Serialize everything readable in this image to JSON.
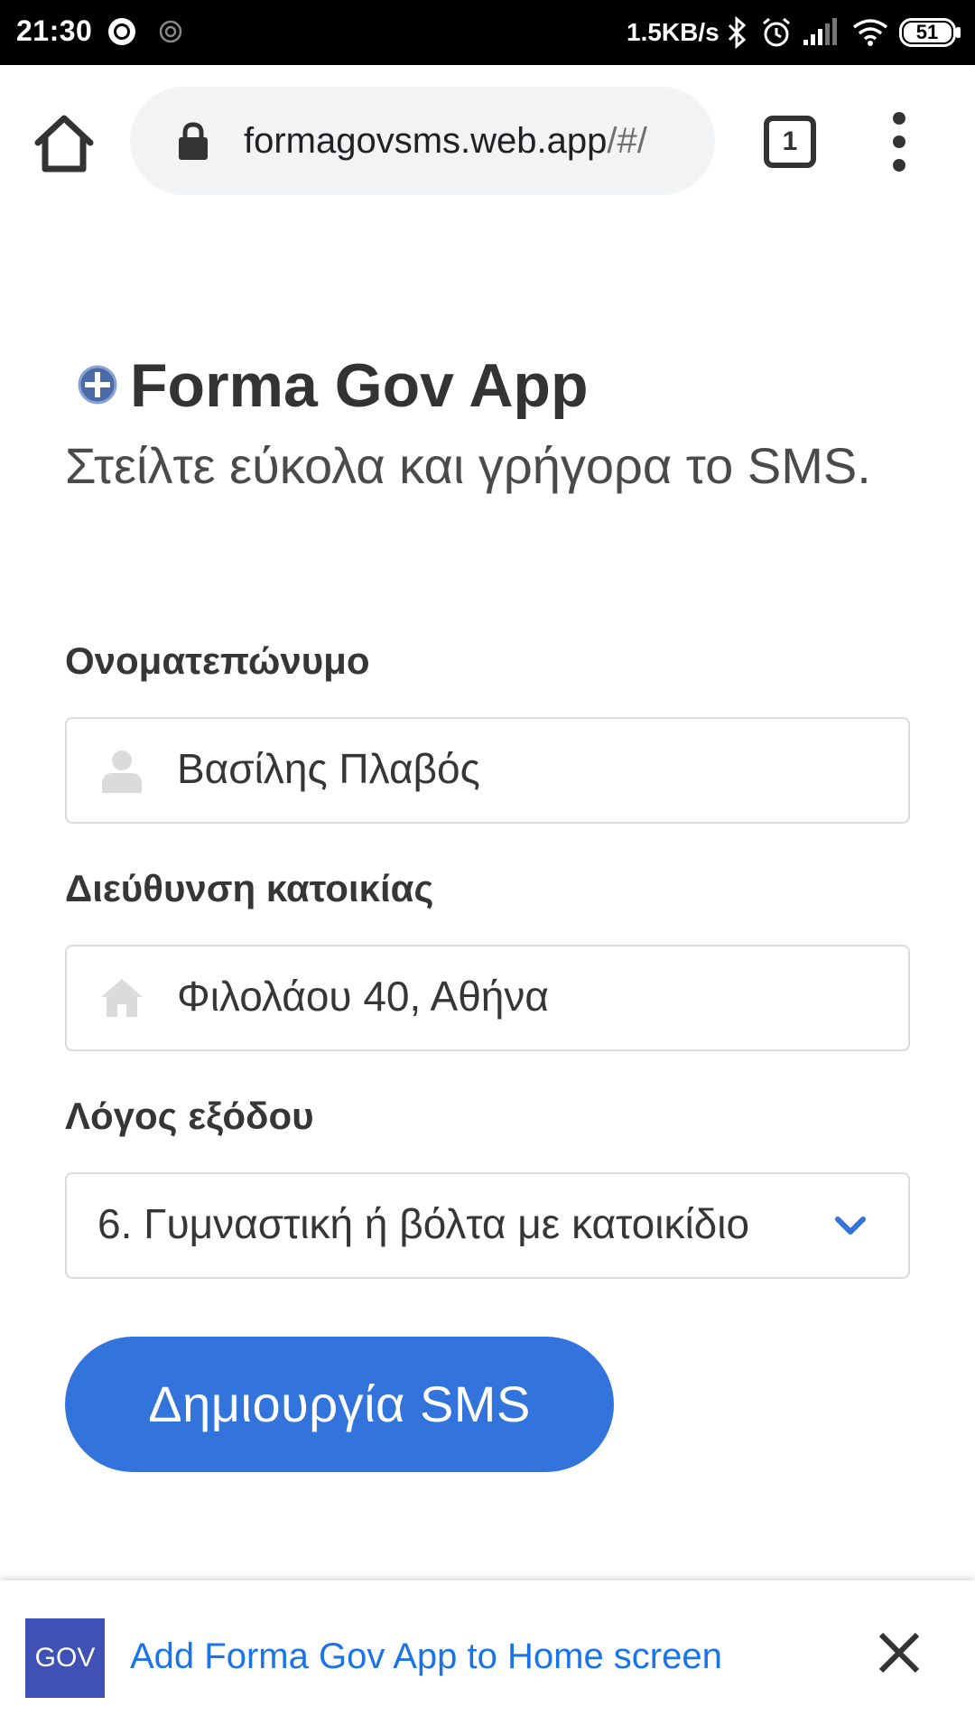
{
  "status_bar": {
    "time": "21:30",
    "net_speed": "1.5KB/s",
    "battery": "51"
  },
  "browser": {
    "url_domain": "formagovsms.web.app",
    "url_path": "/#/",
    "tab_count": "1"
  },
  "page": {
    "title": "Forma Gov App",
    "subtitle": "Στείλτε εύκολα και γρήγορα το SMS.",
    "fields": {
      "name": {
        "label": "Ονοματεπώνυμο",
        "value": "Βασίλης Πλαβός",
        "icon": "user-icon"
      },
      "address": {
        "label": "Διεύθυνση κατοικίας",
        "value": "Φιλολάου 40, Αθήνα",
        "icon": "home-icon"
      },
      "reason": {
        "label": "Λόγος εξόδου",
        "selected": "6. Γυμναστική ή βόλτα με κατοικίδιο"
      }
    },
    "submit_label": "Δημιουργία SMS",
    "accent_color": "#3273dc"
  },
  "install_banner": {
    "app_icon_text": "GOV",
    "text": "Add Forma Gov App to Home screen"
  }
}
